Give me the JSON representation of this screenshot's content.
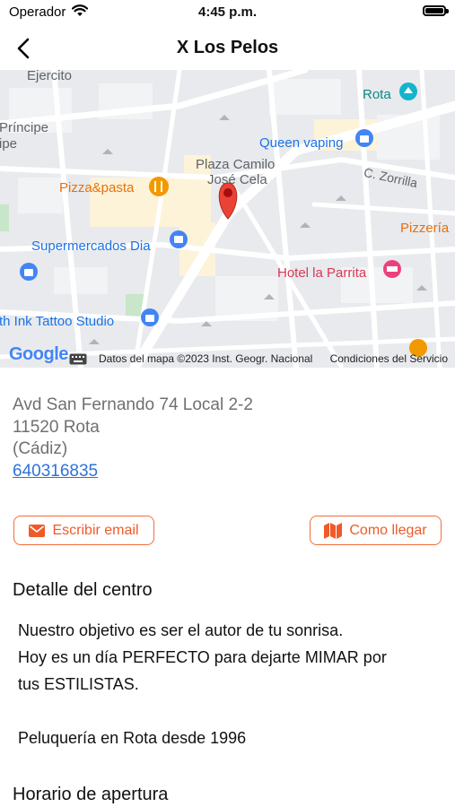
{
  "status_bar": {
    "carrier": "Operador",
    "time": "4:45 p.m."
  },
  "nav": {
    "title": "X Los Pelos"
  },
  "map": {
    "labels": {
      "ejercito": "Ejercito",
      "principe1": "Príncipe",
      "principe2": "ipe",
      "rota": "Rota",
      "queen": "Queen vaping",
      "plaza1": "Plaza Camilo",
      "plaza2": "José Cela",
      "zorrilla": "C. Zorrilla",
      "pizza_pasta": "Pizza&pasta",
      "pizzeria": "Pizzería",
      "dia": "Supermercados Dia",
      "parrita": "Hotel la Parrita",
      "tattoo": "th Ink Tattoo Studio"
    },
    "logo": "Google",
    "attribution": "Datos del mapa ©2023 Inst. Geogr. Nacional",
    "terms": "Condiciones del Servicio"
  },
  "address": {
    "line1": "Avd San Fernando 74 Local 2-2",
    "line2": "11520 Rota",
    "line3": "(Cádiz)",
    "phone": "640316835"
  },
  "actions": {
    "email_label": "Escribir email",
    "route_label": "Como llegar"
  },
  "details": {
    "title": "Detalle del centro",
    "line1": "Nuestro objetivo es ser el autor de tu sonrisa.",
    "line2": "Hoy es un día PERFECTO para dejarte MIMAR por",
    "line3": "tus ESTILISTAS.",
    "line4": "Peluquería en Rota desde 1996"
  },
  "hours": {
    "title": "Horario de apertura"
  },
  "colors": {
    "accent": "#f05a28",
    "link": "#2f73d9",
    "pin": "#ea4335"
  }
}
